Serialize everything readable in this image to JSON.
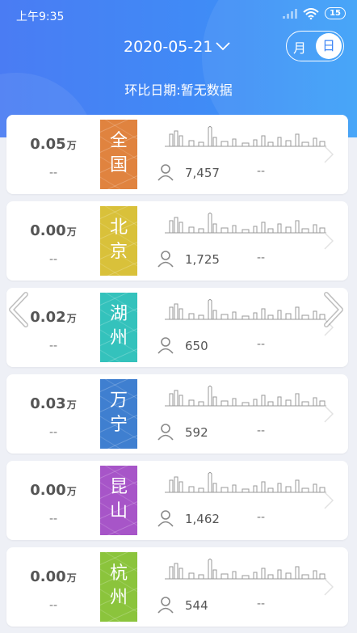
{
  "status": {
    "time": "上午9:35",
    "battery": "15"
  },
  "header": {
    "date": "2020-05-21",
    "toggle_month": "月",
    "toggle_day": "日",
    "compare_date": "环比日期:暂无数据"
  },
  "cards": [
    {
      "amount": "0.05",
      "unit": "万",
      "left_dash": "--",
      "city": "全国",
      "count": "7,457",
      "right_dash": "--",
      "color": "#e0833f"
    },
    {
      "amount": "0.00",
      "unit": "万",
      "left_dash": "--",
      "city": "北京",
      "count": "1,725",
      "right_dash": "--",
      "color": "#d9c13a"
    },
    {
      "amount": "0.02",
      "unit": "万",
      "left_dash": "--",
      "city": "湖州",
      "count": "650",
      "right_dash": "--",
      "color": "#34c2bc"
    },
    {
      "amount": "0.03",
      "unit": "万",
      "left_dash": "--",
      "city": "万宁",
      "count": "592",
      "right_dash": "--",
      "color": "#3f7fd0"
    },
    {
      "amount": "0.00",
      "unit": "万",
      "left_dash": "--",
      "city": "昆山",
      "count": "1,462",
      "right_dash": "--",
      "color": "#a755c8"
    },
    {
      "amount": "0.00",
      "unit": "万",
      "left_dash": "--",
      "city": "杭州",
      "count": "544",
      "right_dash": "--",
      "color": "#8bc43c"
    }
  ]
}
